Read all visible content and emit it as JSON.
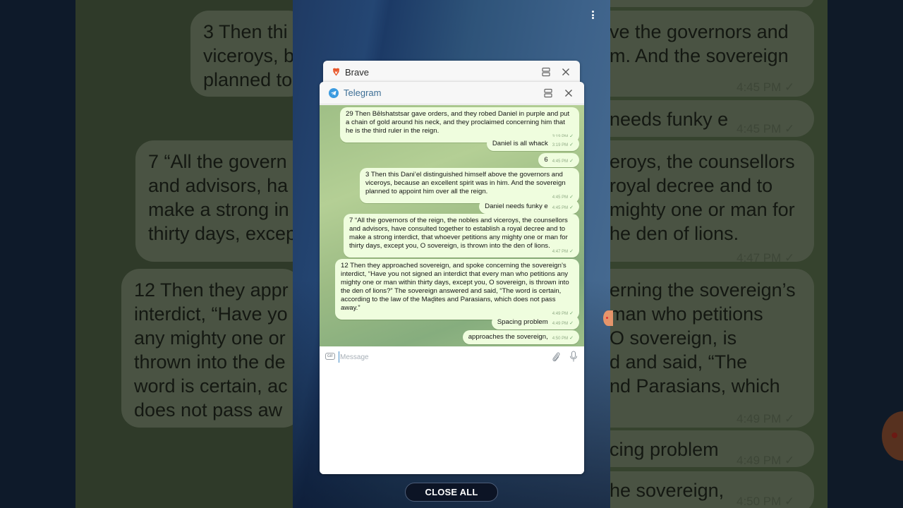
{
  "recents": {
    "more_options_label": "More options",
    "close_all_label": "CLOSE ALL"
  },
  "cards": {
    "brave": {
      "title": "Brave",
      "icon": "brave-lion-icon"
    },
    "telegram": {
      "title": "Telegram",
      "icon": "telegram-plane-icon"
    }
  },
  "chat": {
    "messages": [
      {
        "text": "29 Then Bēlshatstsar gave orders, and they robed Daniel in purple and put a chain of gold around his neck, and they proclaimed concerning him that he is the third ruler in the reign.",
        "time": "3:19 PM",
        "status": "sent"
      },
      {
        "text": "Daniel is all whack",
        "time": "3:19 PM",
        "status": "sent"
      },
      {
        "text": "6",
        "time": "4:45 PM",
        "status": "sent"
      },
      {
        "text": "3 Then this Dani’el distinguished himself above the governors and viceroys, because an excellent spirit was in him. And the sovereign planned to appoint him over all the reign.",
        "time": "4:45 PM",
        "status": "sent"
      },
      {
        "text": "Daniel needs funky e",
        "time": "4:45 PM",
        "status": "sent"
      },
      {
        "text": "7 “All the governors of the reign, the nobles and viceroys, the counsellors and advisors, have consulted together to establish a royal decree and to make a strong interdict, that whoever petitions any mighty one or man for thirty days, except you, O sovereign, is thrown into the den of lions.",
        "time": "4:47 PM",
        "status": "sent"
      },
      {
        "text": "12 Then they approached sovereign, and spoke concerning the sovereign’s interdict, “Have you not signed an interdict that every man who petitions any mighty one or man within thirty days, except you, O sovereign, is thrown into the den of lions?” The sovereign answered and said, “The word is certain, according to the law of the Maḏites and Parasians, which does not pass away.”",
        "time": "4:49 PM",
        "status": "sent"
      },
      {
        "text": "Spacing problem",
        "time": "4:49 PM",
        "status": "sent"
      },
      {
        "text": "approaches the sovereign,",
        "time": "4:50 PM",
        "status": "sent"
      }
    ],
    "check_glyph": "✓"
  },
  "composer": {
    "placeholder": "Message",
    "value": "",
    "gif_label": "GIF"
  },
  "background": {
    "left_bubbles": [
      [
        "3 Then thi",
        "viceroys, b",
        "planned to"
      ],
      [
        "7 “All the govern",
        "and advisors, ha",
        "make a strong in",
        "thirty days, excep"
      ],
      [
        "12 Then they appr",
        "interdict, “Have yo",
        "any mighty one or",
        "thrown into the de",
        "word is certain, ac",
        "does not pass aw"
      ]
    ],
    "right_bubbles": [
      {
        "lines": [
          "ve the governors and",
          "m. And the sovereign"
        ],
        "time": "4:45 PM"
      },
      {
        "lines": [
          "needs funky e"
        ],
        "time": "4:45 PM"
      },
      {
        "lines": [
          "eroys, the counsellors",
          "royal decree and to",
          "mighty one or man for",
          "he den of lions."
        ],
        "time": "4:47 PM"
      },
      {
        "lines": [
          "erning the sovereign’s",
          "man who petitions",
          "O sovereign, is",
          "d and said, “The",
          "nd Parasians, which"
        ],
        "time": "4:49 PM"
      },
      {
        "lines": [
          "cing problem"
        ],
        "time": "4:49 PM"
      },
      {
        "lines": [
          "he sovereign,"
        ],
        "time": "4:50 PM"
      }
    ]
  },
  "colors": {
    "telegram_blue": "#3c9be0",
    "brave_orange": "#e8572b",
    "bubble_out": "#effdde",
    "chat_wallpaper": "#a6c48c"
  }
}
